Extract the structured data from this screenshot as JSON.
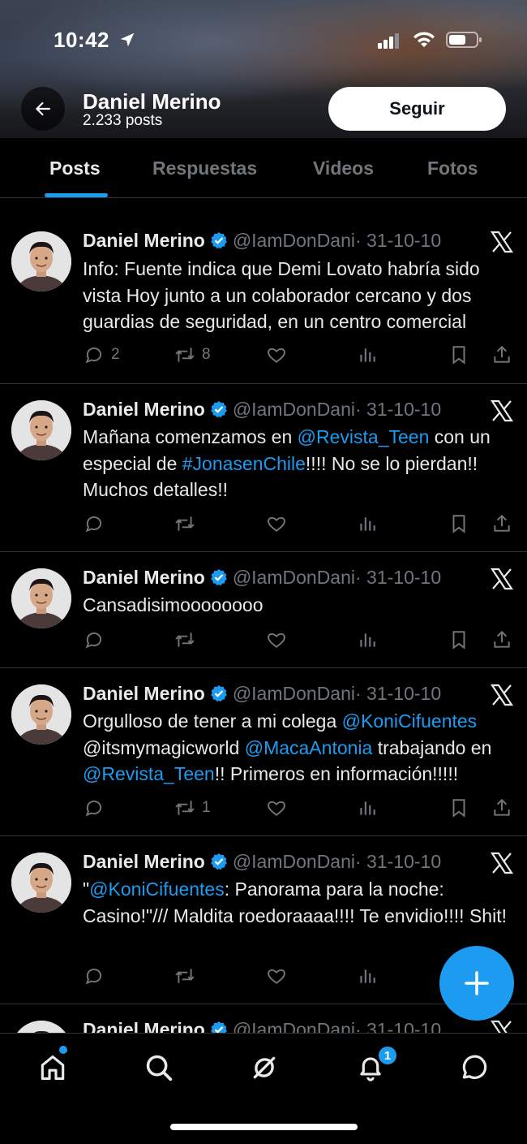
{
  "status_bar": {
    "time": "10:42"
  },
  "header": {
    "name": "Daniel Merino",
    "post_count": "2.233 posts",
    "follow_label": "Seguir"
  },
  "tabs": [
    {
      "label": "Posts",
      "active": true
    },
    {
      "label": "Respuestas",
      "active": false
    },
    {
      "label": "Videos",
      "active": false
    },
    {
      "label": "Fotos",
      "active": false
    }
  ],
  "posts": [
    {
      "name": "Daniel Merino",
      "handle": "@IamDonDani",
      "date": "· 31-10-10",
      "text_parts": [
        "Info: Fuente indica que Demi Lovato habría sido vista Hoy junto a un colaborador cercano y dos guardias de seguridad, en un centro comercial"
      ],
      "replies": "2",
      "reposts": "8"
    },
    {
      "name": "Daniel Merino",
      "handle": "@IamDonDani",
      "date": "· 31-10-10",
      "text_parts": [
        "Mañana comenzamos en ",
        "@Revista_Teen",
        " con un especial de ",
        "#JonasenChile",
        "!!!! No se lo pierdan!! Muchos detalles!!"
      ],
      "replies": "",
      "reposts": ""
    },
    {
      "name": "Daniel Merino",
      "handle": "@IamDonDani",
      "date": "· 31-10-10",
      "text_parts": [
        "Cansadisimoooooooo"
      ],
      "replies": "",
      "reposts": ""
    },
    {
      "name": "Daniel Merino",
      "handle": "@IamDonDani",
      "date": "· 31-10-10",
      "text_parts": [
        "Orgulloso de tener a mi colega ",
        "@KoniCifuentes",
        " @itsmymagicworld ",
        "@MacaAntonia",
        " trabajando en ",
        "@Revista_Teen",
        "!! Primeros en información!!!!!"
      ],
      "replies": "",
      "reposts": "1"
    },
    {
      "name": "Daniel Merino",
      "handle": "@IamDonDani",
      "date": "· 31-10-10",
      "text_parts": [
        "\"",
        "@KoniCifuentes",
        ": Panorama para la noche: Casino!\"/// Maldita roedoraaaa!!!! Te envidio!!!! Shit!"
      ],
      "replies": "",
      "reposts": ""
    },
    {
      "name": "Daniel Merino",
      "handle": "@IamDonDani",
      "date": "· 31-10-10",
      "text_parts": [],
      "replies": "",
      "reposts": ""
    }
  ],
  "nav": {
    "notification_count": "1"
  },
  "colors": {
    "accent": "#1d9bf0",
    "background": "#000000",
    "muted": "#71767b",
    "divider": "#2f3336"
  }
}
